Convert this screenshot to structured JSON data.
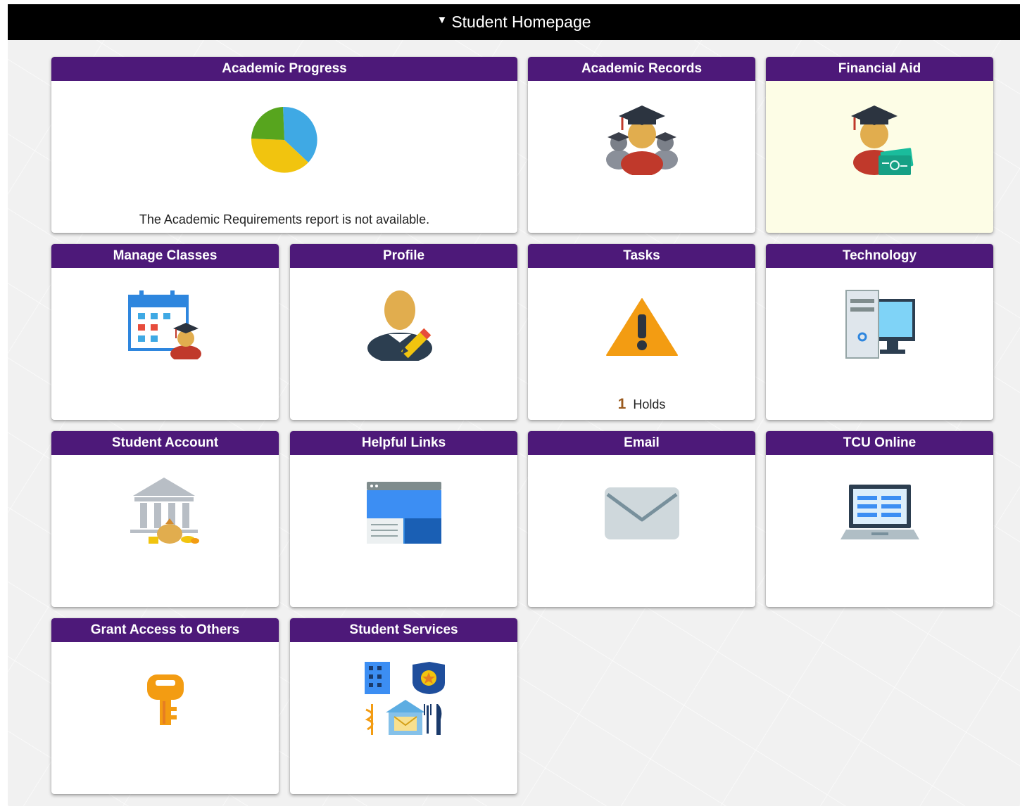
{
  "header": {
    "title": "Student Homepage",
    "caret_icon": "caret-down-icon"
  },
  "colors": {
    "tile_header": "#4d1979",
    "highlight_tile": "#fdfde6",
    "holds_count": "#9a5a1e"
  },
  "tiles": {
    "academic_progress": {
      "title": "Academic Progress",
      "icon": "pie-chart-icon",
      "message": "The Academic Requirements report is not available."
    },
    "academic_records": {
      "title": "Academic Records",
      "icon": "graduates-group-icon"
    },
    "financial_aid": {
      "title": "Financial Aid",
      "icon": "graduate-money-icon"
    },
    "manage_classes": {
      "title": "Manage Classes",
      "icon": "calendar-student-icon"
    },
    "profile": {
      "title": "Profile",
      "icon": "person-edit-icon"
    },
    "tasks": {
      "title": "Tasks",
      "icon": "warning-icon",
      "holds_count": "1",
      "holds_label": "Holds"
    },
    "technology": {
      "title": "Technology",
      "icon": "computer-icon"
    },
    "student_account": {
      "title": "Student Account",
      "icon": "bank-icon"
    },
    "helpful_links": {
      "title": "Helpful Links",
      "icon": "browser-window-icon"
    },
    "email": {
      "title": "Email",
      "icon": "envelope-icon"
    },
    "tcu_online": {
      "title": "TCU Online",
      "icon": "laptop-icon"
    },
    "grant_access": {
      "title": "Grant Access to Others",
      "icon": "key-icon"
    },
    "student_services": {
      "title": "Student Services",
      "icon": "services-icon"
    }
  }
}
